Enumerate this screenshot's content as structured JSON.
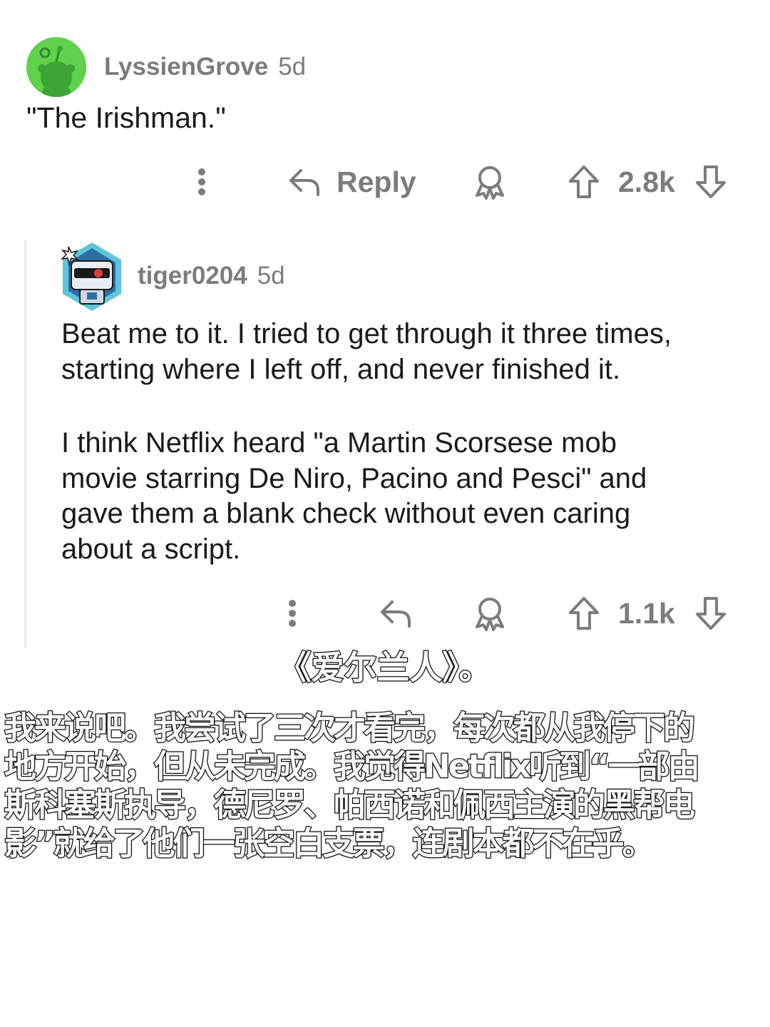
{
  "comments": [
    {
      "author": "LyssienGrove",
      "age": "5d",
      "body": [
        "\"The Irishman.\""
      ],
      "reply_label": "Reply",
      "score": "2.8k"
    },
    {
      "author": "tiger0204",
      "age": "5d",
      "body": [
        "Beat me to it.  I tried to get through it three times,",
        "starting where I left off, and never finished it.",
        "",
        "I think Netflix heard \"a Martin Scorsese mob",
        "movie starring De Niro, Pacino and Pesci\" and",
        "gave them a blank check without even caring",
        "about a script."
      ],
      "score": "1.1k"
    }
  ],
  "subtitles": {
    "line1": "《爱尔兰人》。",
    "line2": [
      "我来说吧。我尝试了三次才看完，每次都从我停下的",
      "地方开始，但从未完成。我觉得Netflix听到“一部由",
      "斯科塞斯执导，德尼罗、帕西诺和佩西主演的黑帮电",
      "影”就给了他们一张空白支票，连剧本都不在乎。"
    ]
  },
  "colors": {
    "meta_gray": "#7c7c7c",
    "text": "#1a1a1b",
    "avatar1_bg": "#5fd14b",
    "thread_line": "#ededed"
  },
  "icons": [
    "reddit-snoo-avatar",
    "robot-avatar",
    "more-options-icon",
    "reply-arrow-icon",
    "award-icon",
    "upvote-icon",
    "downvote-icon"
  ]
}
